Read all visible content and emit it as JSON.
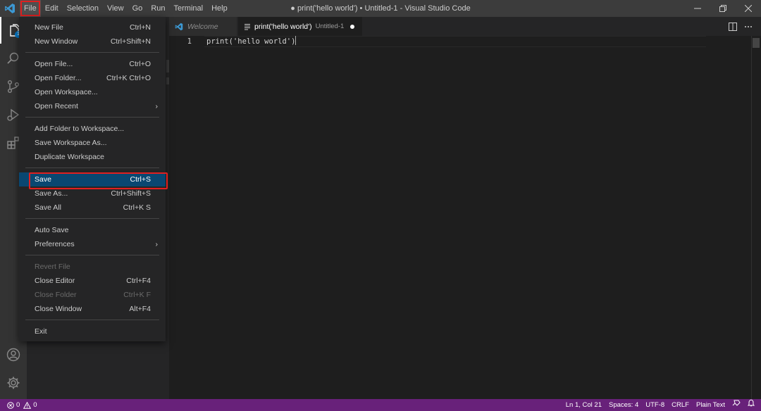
{
  "window": {
    "title": "● print('hello world') • Untitled-1 - Visual Studio Code"
  },
  "menubar": [
    "File",
    "Edit",
    "Selection",
    "View",
    "Go",
    "Run",
    "Terminal",
    "Help"
  ],
  "activity_badge": "1",
  "tabs": [
    {
      "label": "Welcome"
    },
    {
      "label": "print('hello world')",
      "description": "Untitled-1"
    }
  ],
  "editor": {
    "line_number": "1",
    "code": "print('hello world')"
  },
  "file_menu": {
    "group1": [
      {
        "label": "New File",
        "shortcut": "Ctrl+N"
      },
      {
        "label": "New Window",
        "shortcut": "Ctrl+Shift+N"
      }
    ],
    "group2": [
      {
        "label": "Open File...",
        "shortcut": "Ctrl+O"
      },
      {
        "label": "Open Folder...",
        "shortcut": "Ctrl+K Ctrl+O"
      },
      {
        "label": "Open Workspace...",
        "shortcut": ""
      },
      {
        "label": "Open Recent",
        "shortcut": ""
      }
    ],
    "group3": [
      {
        "label": "Add Folder to Workspace...",
        "shortcut": ""
      },
      {
        "label": "Save Workspace As...",
        "shortcut": ""
      },
      {
        "label": "Duplicate Workspace",
        "shortcut": ""
      }
    ],
    "group4": [
      {
        "label": "Save",
        "shortcut": "Ctrl+S"
      },
      {
        "label": "Save As...",
        "shortcut": "Ctrl+Shift+S"
      },
      {
        "label": "Save All",
        "shortcut": "Ctrl+K S"
      }
    ],
    "group5": [
      {
        "label": "Auto Save",
        "shortcut": ""
      },
      {
        "label": "Preferences",
        "shortcut": ""
      }
    ],
    "group6": [
      {
        "label": "Revert File",
        "shortcut": ""
      },
      {
        "label": "Close Editor",
        "shortcut": "Ctrl+F4"
      },
      {
        "label": "Close Folder",
        "shortcut": "Ctrl+K F"
      },
      {
        "label": "Close Window",
        "shortcut": "Alt+F4"
      }
    ],
    "group7": [
      {
        "label": "Exit",
        "shortcut": ""
      }
    ]
  },
  "statusbar": {
    "errors": "0",
    "warnings": "0",
    "position": "Ln 1, Col 21",
    "spaces": "Spaces: 4",
    "encoding": "UTF-8",
    "eol": "CRLF",
    "language": "Plain Text"
  },
  "colors": {
    "accent": "#007acc",
    "statusbar": "#68217a",
    "highlight": "#e02020",
    "selection": "#094771"
  }
}
